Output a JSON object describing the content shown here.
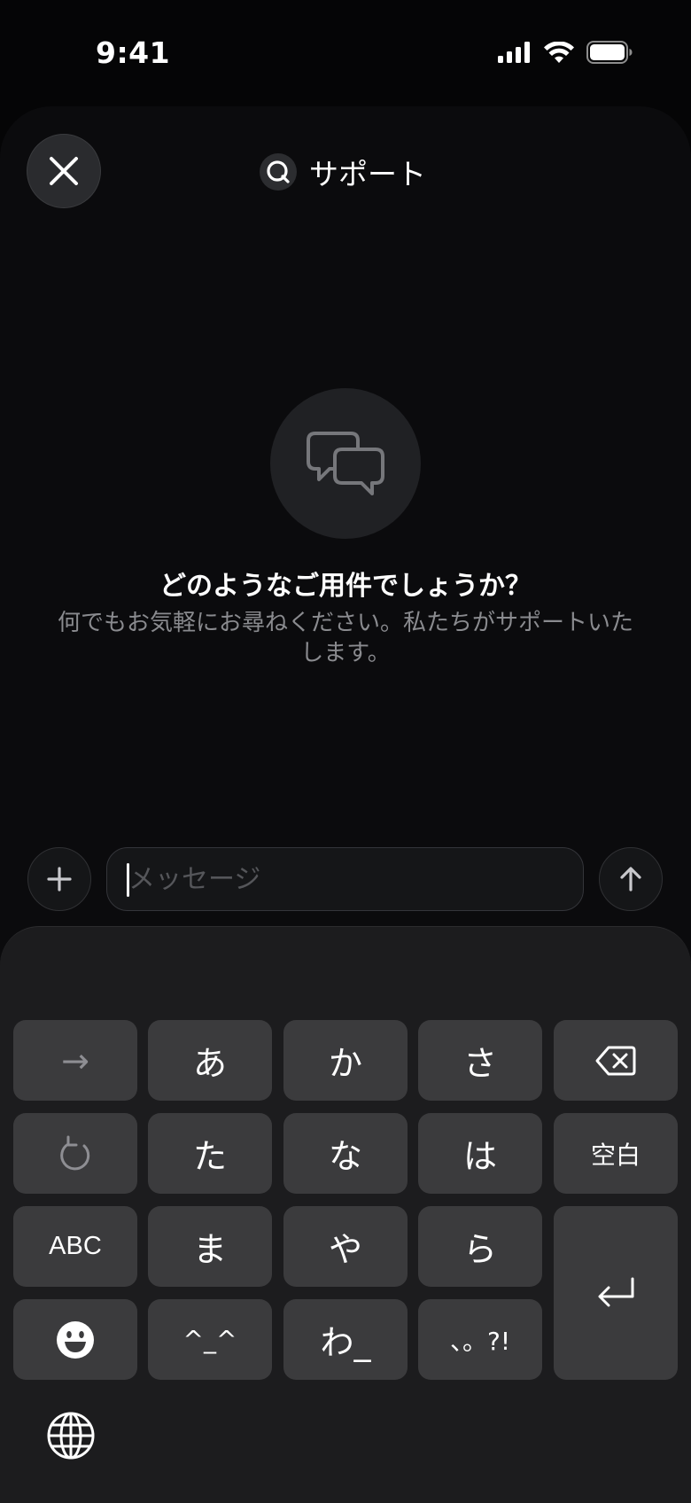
{
  "status_bar": {
    "time": "9:41"
  },
  "header": {
    "title": "サポート"
  },
  "empty_state": {
    "title": "どのようなご用件でしょうか？",
    "subtitle": "何でもお気軽にお尋ねください。私たちがサポートいたします。"
  },
  "composer": {
    "placeholder": "メッセージ"
  },
  "keyboard": {
    "rows": [
      [
        "→",
        "あ",
        "か",
        "さ",
        "delete"
      ],
      [
        "undo",
        "た",
        "な",
        "は",
        "空白"
      ],
      [
        "ABC",
        "ま",
        "や",
        "ら",
        "return"
      ],
      [
        "emoji",
        "^_^",
        "わ_",
        "、。?!"
      ]
    ],
    "key_arrow": "→",
    "key_a": "あ",
    "key_ka": "か",
    "key_sa": "さ",
    "key_ta": "た",
    "key_na": "な",
    "key_ha": "は",
    "key_space": "空白",
    "key_abc": "ABC",
    "key_ma": "ま",
    "key_ya": "や",
    "key_ra": "ら",
    "key_kaomoji": "^_^",
    "key_wa": "わ_",
    "key_punct": "、。?!"
  },
  "colors": {
    "background": "#050506",
    "sheet": "#0b0b0d",
    "keyboard": "#1c1c1e",
    "key": "#3b3b3d",
    "muted_text": "#8a8b8f"
  }
}
